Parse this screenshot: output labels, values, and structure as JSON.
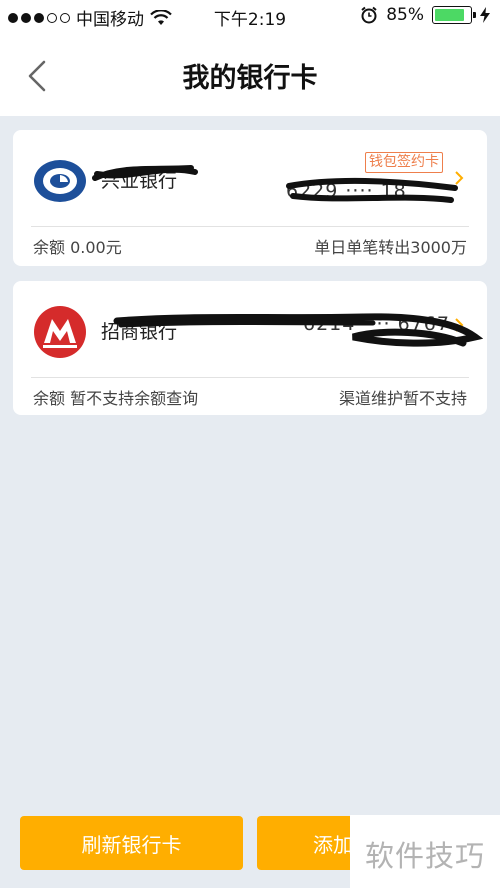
{
  "status_bar": {
    "carrier": "中国移动",
    "time": "下午2:19",
    "battery": "85%",
    "battery_level": 0.85
  },
  "nav": {
    "title": "我的银行卡"
  },
  "cards": [
    {
      "bank_name": "兴业银行",
      "card_number": "6229 ···· 18",
      "badge": "钱包签约卡",
      "balance": "余额 0.00元",
      "limit": "单日单笔转出3000万"
    },
    {
      "bank_name": "招商银行",
      "card_number": "6214 ···· 6767",
      "balance": "余额 暂不支持余额查询",
      "limit": "渠道维护暂不支持"
    }
  ],
  "buttons": {
    "refresh": "刷新银行卡",
    "add": "添加"
  },
  "watermark": "软件技巧",
  "colors": {
    "accent": "#ffae00",
    "badge": "#ee7f4c",
    "cib_blue": "#1d4f9a",
    "cmb_red": "#d52b2b",
    "chevron": "#ffae00"
  }
}
